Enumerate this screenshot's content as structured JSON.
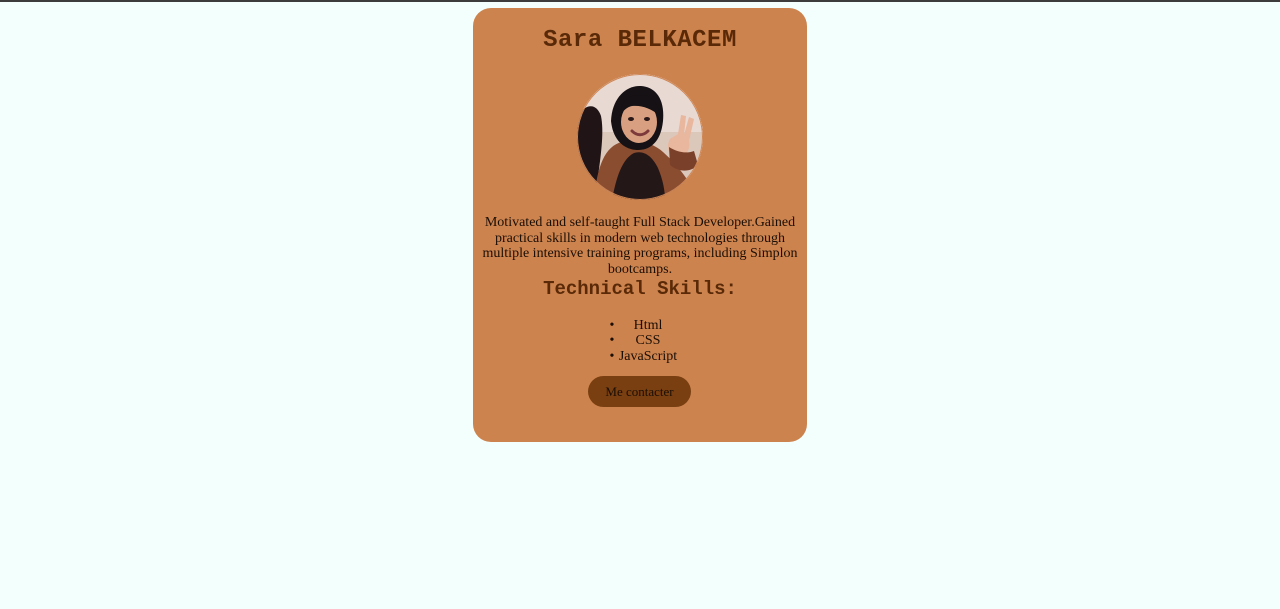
{
  "profile": {
    "name": "Sara BELKACEM",
    "bio": "Motivated and self-taught Full Stack Developer.Gained practical skills in modern web technologies through multiple intensive training programs, including Simplon bootcamps.",
    "skills_title": "Technical Skills:",
    "skills": [
      {
        "label": "Html"
      },
      {
        "label": "CSS"
      },
      {
        "label": "JavaScript"
      }
    ],
    "contact_label": "Me contacter"
  },
  "colors": {
    "page_background": "#f3fffd",
    "card_background": "#cd834e",
    "heading": "#5a2a08",
    "button_background": "#7a3f11"
  },
  "icons": {
    "bullet": "•",
    "avatar": "profile-photo"
  }
}
